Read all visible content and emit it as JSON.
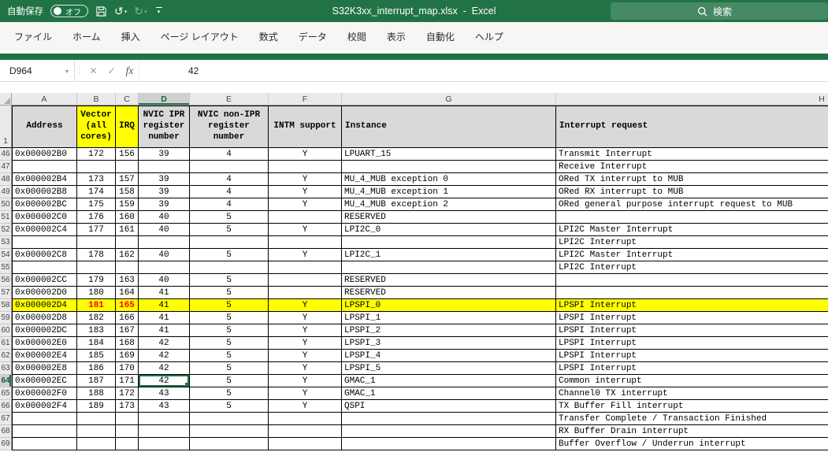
{
  "title_bar": {
    "autosave_label": "自動保存",
    "autosave_state": "オフ",
    "title": "S32K3xx_interrupt_map.xlsx  -  Excel",
    "search_placeholder": "検索"
  },
  "icons": {
    "undo": "↺",
    "redo": "↻",
    "caret": "▾",
    "dots": "⋮",
    "cancel": "✕",
    "enter": "✓"
  },
  "ribbon": {
    "tabs": [
      "ファイル",
      "ホーム",
      "挿入",
      "ページ レイアウト",
      "数式",
      "データ",
      "校閲",
      "表示",
      "自動化",
      "ヘルプ"
    ]
  },
  "formula_bar": {
    "name_box": "D964",
    "fx_label": "fx",
    "value": "42"
  },
  "colors": {
    "excel_green": "#217346",
    "highlight_yellow": "#FFFF00",
    "header_gray": "#D9D9D9",
    "changed_text_red": "#FF0000",
    "selection_green": "#217346"
  },
  "grid": {
    "frozen_row_label": "1",
    "visible_columns": [
      "A",
      "B",
      "C",
      "D",
      "E",
      "F",
      "G",
      "H"
    ],
    "selected_column": "D",
    "header_row": {
      "address": "Address",
      "vector": "Vector\n(all\ncores)",
      "irq": "IRQ",
      "ipr": "NVIC IPR\nregister\nnumber",
      "non_ipr": "NVIC non-IPR\nregister\nnumber",
      "intm": "INTM support",
      "instance": "Instance",
      "request": "Interrupt request"
    },
    "rows": [
      {
        "n": "46",
        "address": "0x000002B0",
        "vector": "172",
        "irq": "156",
        "ipr": "39",
        "non_ipr": "4",
        "intm": "Y",
        "instance": "LPUART_15",
        "request": "Transmit Interrupt"
      },
      {
        "n": "47",
        "address": "",
        "vector": "",
        "irq": "",
        "ipr": "",
        "non_ipr": "",
        "intm": "",
        "instance": "",
        "request": "Receive Interrupt"
      },
      {
        "n": "48",
        "address": "0x000002B4",
        "vector": "173",
        "irq": "157",
        "ipr": "39",
        "non_ipr": "4",
        "intm": "Y",
        "instance": "MU_4_MUB exception 0",
        "request": "ORed TX interrupt to MUB"
      },
      {
        "n": "49",
        "address": "0x000002B8",
        "vector": "174",
        "irq": "158",
        "ipr": "39",
        "non_ipr": "4",
        "intm": "Y",
        "instance": "MU_4_MUB exception 1",
        "request": "ORed RX interrupt to MUB"
      },
      {
        "n": "50",
        "address": "0x000002BC",
        "vector": "175",
        "irq": "159",
        "ipr": "39",
        "non_ipr": "4",
        "intm": "Y",
        "instance": "MU_4_MUB exception 2",
        "request": "ORed general purpose interrupt request to MUB"
      },
      {
        "n": "51",
        "address": "0x000002C0",
        "vector": "176",
        "irq": "160",
        "ipr": "40",
        "non_ipr": "5",
        "intm": "",
        "instance": "RESERVED",
        "request": ""
      },
      {
        "n": "52",
        "address": "0x000002C4",
        "vector": "177",
        "irq": "161",
        "ipr": "40",
        "non_ipr": "5",
        "intm": "Y",
        "instance": "LPI2C_0",
        "request": "LPI2C Master Interrupt"
      },
      {
        "n": "53",
        "address": "",
        "vector": "",
        "irq": "",
        "ipr": "",
        "non_ipr": "",
        "intm": "",
        "instance": "",
        "request": "LPI2C Interrupt"
      },
      {
        "n": "54",
        "address": "0x000002C8",
        "vector": "178",
        "irq": "162",
        "ipr": "40",
        "non_ipr": "5",
        "intm": "Y",
        "instance": "LPI2C_1",
        "request": "LPI2C Master Interrupt"
      },
      {
        "n": "55",
        "address": "",
        "vector": "",
        "irq": "",
        "ipr": "",
        "non_ipr": "",
        "intm": "",
        "instance": "",
        "request": "LPI2C Interrupt"
      },
      {
        "n": "56",
        "address": "0x000002CC",
        "vector": "179",
        "irq": "163",
        "ipr": "40",
        "non_ipr": "5",
        "intm": "",
        "instance": "RESERVED",
        "request": ""
      },
      {
        "n": "57",
        "address": "0x000002D0",
        "vector": "180",
        "irq": "164",
        "ipr": "41",
        "non_ipr": "5",
        "intm": "",
        "instance": "RESERVED",
        "request": ""
      },
      {
        "n": "58",
        "address": "0x000002D4",
        "vector": "181",
        "irq": "165",
        "ipr": "41",
        "non_ipr": "5",
        "intm": "Y",
        "instance": "LPSPI_0",
        "request": "LPSPI Interrupt",
        "highlight": true,
        "red": true
      },
      {
        "n": "59",
        "address": "0x000002D8",
        "vector": "182",
        "irq": "166",
        "ipr": "41",
        "non_ipr": "5",
        "intm": "Y",
        "instance": "LPSPI_1",
        "request": "LPSPI Interrupt"
      },
      {
        "n": "60",
        "address": "0x000002DC",
        "vector": "183",
        "irq": "167",
        "ipr": "41",
        "non_ipr": "5",
        "intm": "Y",
        "instance": "LPSPI_2",
        "request": "LPSPI Interrupt"
      },
      {
        "n": "61",
        "address": "0x000002E0",
        "vector": "184",
        "irq": "168",
        "ipr": "42",
        "non_ipr": "5",
        "intm": "Y",
        "instance": "LPSPI_3",
        "request": "LPSPI Interrupt"
      },
      {
        "n": "62",
        "address": "0x000002E4",
        "vector": "185",
        "irq": "169",
        "ipr": "42",
        "non_ipr": "5",
        "intm": "Y",
        "instance": "LPSPI_4",
        "request": "LPSPI Interrupt"
      },
      {
        "n": "63",
        "address": "0x000002E8",
        "vector": "186",
        "irq": "170",
        "ipr": "42",
        "non_ipr": "5",
        "intm": "Y",
        "instance": "LPSPI_5",
        "request": "LPSPI Interrupt"
      },
      {
        "n": "64",
        "address": "0x000002EC",
        "vector": "187",
        "irq": "171",
        "ipr": "42",
        "non_ipr": "5",
        "intm": "Y",
        "instance": "GMAC_1",
        "request": "Common interrupt",
        "selected": true
      },
      {
        "n": "65",
        "address": "0x000002F0",
        "vector": "188",
        "irq": "172",
        "ipr": "43",
        "non_ipr": "5",
        "intm": "Y",
        "instance": "GMAC_1",
        "request": "Channel0 TX interrupt"
      },
      {
        "n": "66",
        "address": "0x000002F4",
        "vector": "189",
        "irq": "173",
        "ipr": "43",
        "non_ipr": "5",
        "intm": "Y",
        "instance": "QSPI",
        "request": "TX Buffer Fill interrupt"
      },
      {
        "n": "67",
        "address": "",
        "vector": "",
        "irq": "",
        "ipr": "",
        "non_ipr": "",
        "intm": "",
        "instance": "",
        "request": "Transfer Complete / Transaction Finished"
      },
      {
        "n": "68",
        "address": "",
        "vector": "",
        "irq": "",
        "ipr": "",
        "non_ipr": "",
        "intm": "",
        "instance": "",
        "request": "RX Buffer Drain interrupt"
      },
      {
        "n": "69",
        "address": "",
        "vector": "",
        "irq": "",
        "ipr": "",
        "non_ipr": "",
        "intm": "",
        "instance": "",
        "request": "Buffer Overflow / Underrun interrupt"
      }
    ]
  }
}
